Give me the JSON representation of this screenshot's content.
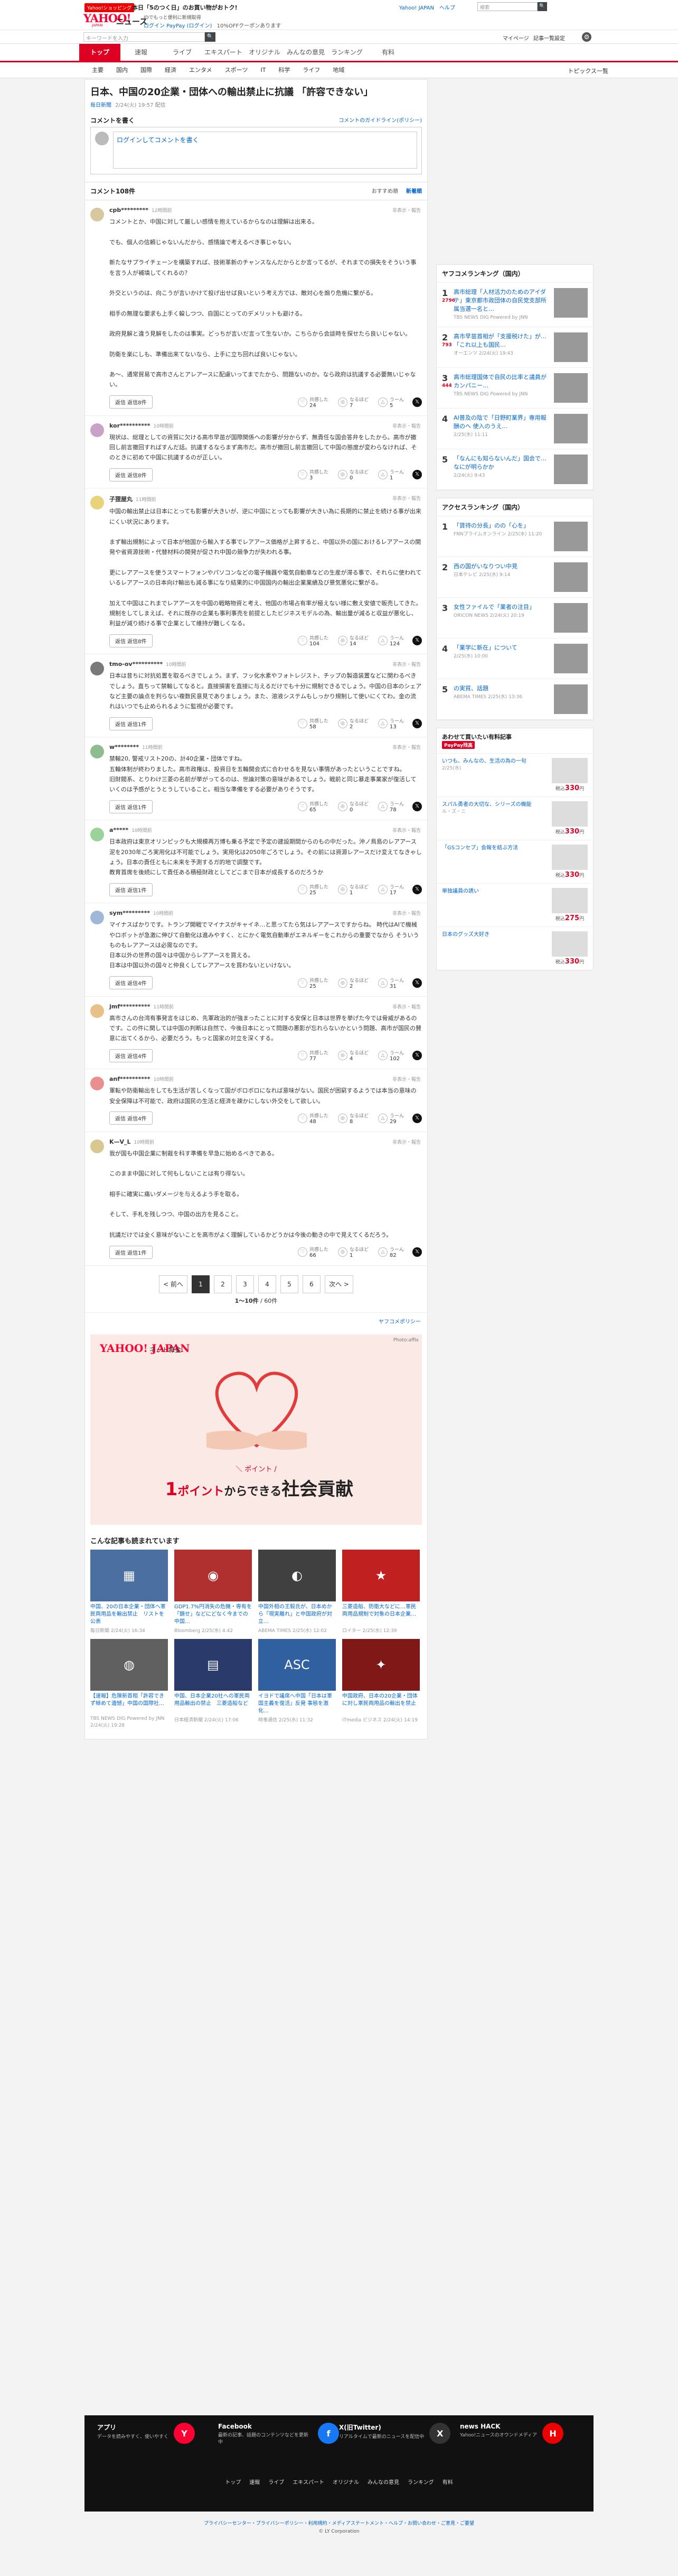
{
  "promo": {
    "badge": "Yahoo!ショッピング",
    "text": "本日「5のつく日」のお買い物がおトク!"
  },
  "header": {
    "logo_main": "YAHOO!",
    "logo_sub": "JAPAN",
    "logo_news": "ニュース",
    "tagline": "IDでもっと便利に新規取得",
    "login": "ログイン",
    "login_extra": "PayPay (ログイン)",
    "campaign": "10%OFFクーポンあります",
    "links": "Yahoo! JAPAN　ヘルプ",
    "top_search_placeholder": "検索",
    "search_placeholder": "キーワードを入力",
    "search_icon_label": "🔍",
    "mypage": "マイページ",
    "settings": "記事一覧設定"
  },
  "nav_main": [
    "トップ",
    "速報",
    "ライブ",
    "エキスパート",
    "オリジナル",
    "みんなの意見",
    "ランキング",
    "有料"
  ],
  "nav_sub": [
    "主要",
    "国内",
    "国際",
    "経済",
    "エンタメ",
    "スポーツ",
    "IT",
    "科学",
    "ライフ",
    "地域"
  ],
  "nav_topics": "トピックス一覧",
  "article": {
    "title": "日本、中国の20企業・団体への輸出禁止に抗議 「許容できない」",
    "source": "毎日新聞",
    "date": "2/24(火) 19:57 配信"
  },
  "comment_form": {
    "heading": "コメントを書く",
    "policy": "コメントのガイドライン(ポリシー)",
    "placeholder": "ログインしてコメントを書く"
  },
  "comment_list": {
    "count": "コメント108件",
    "sort_recommended": "おすすめ順",
    "sort_new": "新着順"
  },
  "reply_label": "返信",
  "report_label": "非表示・報告",
  "vote_labels": {
    "agree": "共感した",
    "think": "なるほど",
    "disagree": "うーん"
  },
  "comments": [
    {
      "user": "cpb*********",
      "ago": "12時間前",
      "replies": "返信8件",
      "agree": "24",
      "think": "7",
      "disagree": "5",
      "avatar_color": "#d9c7a0",
      "body": "コメントとか、中国に対して厳しい感情を抱えているからなのは理解は出来る。\n\nでも、個人の信頼じゃないんだから、感情論で考えるべき事じゃない。\n\n新たなサプライチェーンを構築すれば、技術革新のチャンスなんだからとか言ってるが、それまでの損失をそういう事を言う人が補填してくれるの？\n\n外交というのは、向こうが言いかけて投げ出せば良いという考え方では、敵対心を煽り危機に繋がる。\n\n相手の無理な要求も上手く躱しつつ、自国にとってのデメリットも避ける。\n\n政府見解と違う見解をしたのは事実。どっちが言いだ言って生ないか。こちらから会談時を探せたら良いじゃない。\n\n防衛を楽にしも、準備出来てないなら、上手に立ち回れば良いじゃない。\n\nあ〜、通常貿易で高市さんとアレアースに配慮いってまでたから、問題ないのか。なら政府は抗議する必要無いじゃない。"
    },
    {
      "user": "kor**********",
      "ago": "10時間前",
      "replies": "返信8件",
      "agree": "3",
      "think": "0",
      "disagree": "1",
      "avatar_color": "#c8a2c8",
      "body": "現状は、総理としての資質に欠ける高市早苗が国際関係への影響が分からず、無責任な国会答弁をしたから。高市が撤回し前言撤回すればすんだ話。抗議するならまず高市だ。高市が撤回し前言撤回して中国の態度が変わらなければ、そのときに初めて中国に抗議するのが正しい。"
    },
    {
      "user": "子狸屋丸",
      "ago": "11時間前",
      "replies": "返信8件",
      "agree": "104",
      "think": "14",
      "disagree": "124",
      "avatar_color": "#e8d27a",
      "body": "中国の輸出禁止は日本にとっても影響が大きいが、逆に中国にとっても影響が大きい為に長期的に禁止を続ける事が出来にくい状況にあります。\n\nまず輸出規制によって日本が他国から輸入する事でレアアース価格が上昇すると、中国以外の国におけるレアアースの開発や省資源技術・代替材料の開発が促され中国の競争力が失われる事。\n\n更にレアアースを使うスマートフォンやパソコンなどの電子機器や電気自動車などの生産が滞る事で、それらに使われているレアアースの日本向け輸出も減る事になり結果的に中国国内の輸出企業業績及び景気悪化に繋がる。\n\n加えて中国はこれまでレアアースを中国の戦略物資と考え、他国の市場占有率が極えない様に敷え安値で販売してきた。規制をしてしまえば、それに既存の企業も事利事売を前提としたビジネスモデルの為、輸出量が減ると収益が悪化し、利益が減り続ける事で企業として維持が難しくなる。"
    },
    {
      "user": "tmo-ov**********",
      "ago": "10時間前",
      "replies": "返信1件",
      "agree": "58",
      "think": "2",
      "disagree": "13",
      "avatar_color": "#7a7a7a",
      "body": "日本は昔ちに対抗処置を取るべきでしょう。まず、フッ化水素やフォトレジスト、チップの製造装置などに関わるべきでしょう。直ちって禁輸してなると。直接損害を直接に与えるだけでも十分に規制できるでしょう。中国の日本のシェアなど主要の論点を判らない複数民意見でありましょう。また、溶液システムもしっかり規制して使いにくてわ。金の流れはいつでも止められるように監視が必要です。"
    },
    {
      "user": "w********",
      "ago": "11時間前",
      "replies": "返信1件",
      "agree": "65",
      "think": "0",
      "disagree": "78",
      "avatar_color": "#8fbc8f",
      "body": "禁輸20, 警戒リスト20の、計40企業・団体ですね。\n五輪体制が終わりました。高市政権は、投資日を五輪開会式に合わせるを見ない事情があったということですね。\n旧財閥系、とりわけ三菱の名前が挙がってるのは、世論対策の意味があるでしょう。戦前と同じ暴走事業家が復活していくのは予感がとうとうしていること。相当な準備をする必要がありそうです。"
    },
    {
      "user": "a*****",
      "ago": "10時間前",
      "replies": "返信1件",
      "agree": "25",
      "think": "1",
      "disagree": "17",
      "avatar_color": "#9bd19b",
      "body": "日本政府は東京オリンピックも大規模再万博も乗る予定で予定の建設期間からのもの中だった。沖ノ鳥島のレアアース泥を2030年ごろ実用化は不可能でしょう。実用化は2050年ごろでしょう。その前には資源レアースだけ変えてなきゃしょう。日本の責任ともに未来を予測するガ的地で調整です。\n教育首席を後続にして責任ある積極財政としてどこまで日本が成長するのだろうか"
    },
    {
      "user": "sym*********",
      "ago": "10時間前",
      "replies": "返信4件",
      "agree": "25",
      "think": "2",
      "disagree": "31",
      "avatar_color": "#a0b8d8",
      "body": "マイナスばかりです。トランプ開戦でマイナスがキャイネ…と思ってたら気はレアアースですからね。 時代はAIで機械やロボットが急激に伸びて自動化は進みやすく、とにかく電気自動車がエネルギーをこれからの重要でなから そういうものもレアアースは必需なのです。\n日本以外の世界の国々は中国からレアアースを買える。\n日本は中国以外の国々と仲良くしてレアアースを買わないといけない。"
    },
    {
      "user": "jmf**********",
      "ago": "11時間前",
      "replies": "返信4件",
      "agree": "77",
      "think": "4",
      "disagree": "102",
      "avatar_color": "#e8c08a",
      "body": "高市さんの台湾有事発言をはじめ、先軍政治的が強まったことに対する安保と日本は世界を挙げた今では脅威があるのです。この件に関しては中国の判断は自然で、今後日本にとって問題の悪影が忘れらないかという問題、高市が国民の賛意に出てくるから、必要だろう。もっと国家の対立を深くする。"
    },
    {
      "user": "anf**********",
      "ago": "10時間前",
      "replies": "返信4件",
      "agree": "48",
      "think": "8",
      "disagree": "29",
      "avatar_color": "#e89090",
      "body": "軍転や防衛輸出をしても生活が苦しくなって国がボロボロになれば意味がない。国民が困窮するようでは本当の意味の安全保障は不可能で、政府は国民の生活と経済を疎かにしない外交をして欲しい。"
    },
    {
      "user": "K—V_L",
      "ago": "10時間前",
      "replies": "返信1件",
      "agree": "66",
      "think": "1",
      "disagree": "82",
      "avatar_color": "#d8c890",
      "body": "我が国も中国企業に制裁を科す準備を早急に始めるべきである。\n\nこのまま中国に対して何もしないことは有り得ない。\n\n相手に確実に痛いダメージを与えるよう手を取る。\n\nそして、手札を残しつつ、中国の出方を見ること。\n\n抗議だけでは全く意味がないことを高市がよく理解しているかどうかは今後の動きの中で見えてくるだろう。"
    }
  ],
  "pager": {
    "prev": "< 前へ",
    "next": "次へ >",
    "pages": [
      "1",
      "2",
      "3",
      "4",
      "5",
      "6"
    ],
    "info_range": "1〜10件",
    "info_total": "/ 60件"
  },
  "policy_link": "ヤフコメポリシー",
  "ad": {
    "logo": "YAHOO! JAPAN",
    "label": "ネット募金",
    "photo": "Photo:affix",
    "sub": "＼ ポイント /",
    "copy_num": "1",
    "copy_a": "ポイント",
    "copy_b": "からできる",
    "copy_c": "社会貢献"
  },
  "more": {
    "heading": "こんな記事も読まれています",
    "items": [
      {
        "title": "中国、20の日本企業・団体へ軍民両用品を輸出禁止　リストを公表",
        "meta": "毎日新聞",
        "time": "2/24(火) 16:34",
        "color": "#4a6fa0",
        "glyph": "▦"
      },
      {
        "title": "GDP1.7%円消失の危機・専有を「鏡せ」などにどなく今までの中国…",
        "meta": "Bloomberg",
        "time": "2/25(水) 4:42",
        "color": "#b03030",
        "glyph": "◉"
      },
      {
        "title": "中国外相の王毅氏が、日本めから「現実離れ」と中国政府が対立…",
        "meta": "ABEMA TIMES",
        "time": "2/25(水) 12:02",
        "color": "#404040",
        "glyph": "◐"
      },
      {
        "title": "三菱造船、防衛大などに…軍民両用品規制で対象の日本企業…",
        "meta": "ロイター",
        "time": "2/25(水) 12:39",
        "color": "#c02020",
        "glyph": "★"
      },
      {
        "title": "【速報】危険新首相「許容できず極めて遺憾」中国の国際社…",
        "meta": "TBS NEWS DIG Powered by JNN",
        "time": "2/24(火) 19:28",
        "color": "#606060",
        "glyph": "◍"
      },
      {
        "title": "中国、日本企業20社への軍民両用品輸出の禁止　三菱造船など",
        "meta": "日本経済新聞",
        "time": "2/24(火) 17:06",
        "color": "#2a3a6a",
        "glyph": "▤"
      },
      {
        "title": "イヨドで議席へ中国「日本は軍国主義を復活」反発 事態を激化…",
        "meta": "時事通信",
        "time": "2/25(水) 11:32",
        "color": "#3060a0",
        "glyph": "ASC"
      },
      {
        "title": "中国政府、日本の20企業・団体に対し軍民両用品の輸出を禁止",
        "meta": "ITmedia ビジネス",
        "time": "2/24(火) 14:19",
        "color": "#801818",
        "glyph": "✦"
      }
    ]
  },
  "ranking": {
    "heading": "ヤフコメランキング（国内）",
    "items": [
      {
        "no": "1",
        "comments": "2796",
        "title": "高市総理「人材活力のためのアイダテ」東京都市政団体の自民党支部所属当選一名と…",
        "meta": "TBS NEWS DIG Powered by JNN"
      },
      {
        "no": "2",
        "comments": "793",
        "title": "高市早苗首相が「支援税けた」が…「これ以上も国民…",
        "meta": "オーエンツ 2/24(火) 19:43"
      },
      {
        "no": "3",
        "comments": "444",
        "title": "高市総理国体で自民の比率と議員がカンパニー…",
        "meta": "TBS NEWS DIG Powered by JNN"
      },
      {
        "no": "4",
        "comments": "",
        "title": "AI普及の陰で「日野町業界」専用報酬のへ 使入のうえ…",
        "meta": "2/25(水) 11:11"
      },
      {
        "no": "5",
        "comments": "",
        "title": "「なんにも知らないんだ」国会で…なにが明らかか",
        "meta": "2/24(火) 9:43"
      }
    ]
  },
  "access_ranking": {
    "heading": "アクセスランキング（国内）",
    "items": [
      {
        "no": "1",
        "title": "「賃待の分長」のの「心を」",
        "meta": "FNNプライムオンライン 2/25(水) 11:20"
      },
      {
        "no": "2",
        "title": "西の国がいなりつい中見",
        "meta": "日本テレビ 2/25(水) 9:14"
      },
      {
        "no": "3",
        "title": "女性ファイルで「業者の注目」",
        "meta": "ORICON NEWS 2/24(火) 20:19"
      },
      {
        "no": "4",
        "title": "「業学に新在」について",
        "meta": "2/25(水) 10:00"
      },
      {
        "no": "5",
        "title": "の実質、話題",
        "meta": "ABEMA TIMES 2/25(水) 13:36"
      }
    ]
  },
  "shopping": {
    "pp": "PayPay残高",
    "heading": "あわせて買いたい有料記事",
    "items": [
      {
        "title": "いつも、みんなの、生活の為の一句",
        "sub": "2/25(水)",
        "price": "330"
      },
      {
        "title": "スパル勇者の大切な、シリーズの機能",
        "sub": "ル・ズ・ニ",
        "price": "330"
      },
      {
        "title": "「GSコンセプ」会報を結ぶ方法",
        "sub": "",
        "price": "330"
      },
      {
        "title": "単独議員の誘い",
        "sub": "",
        "price": "275"
      },
      {
        "title": "日本のグッズ大好き",
        "sub": "",
        "price": "330"
      }
    ]
  },
  "footer": {
    "blocks": [
      {
        "title": "アプリ",
        "desc": "データを読みやすく、使いやすく",
        "icon": "Y",
        "color": "#ff0033"
      },
      {
        "title": "Facebook",
        "desc": "最新の記事、話題のコンテンツなどを更新中",
        "icon": "f",
        "color": "#1877f2"
      },
      {
        "title": "X(旧Twitter)",
        "desc": "リアルタイムで最新のニュースを配信中",
        "icon": "X",
        "color": "#333"
      },
      {
        "title": "news HACK",
        "desc": "Yahoo!ニュースのオウンドメディア",
        "icon": "H",
        "color": "#e00"
      }
    ],
    "nav": [
      "トップ",
      "速報",
      "ライブ",
      "エキスパート",
      "オリジナル",
      "みんなの意見",
      "ランキング",
      "有料"
    ]
  },
  "bottom": {
    "links": "プライバシーセンター・プライバシーポリシー・利用規約・メディアステートメント・ヘルプ・お問い合わせ・ご意見・ご要望",
    "copyright": "© LY Corporation"
  }
}
